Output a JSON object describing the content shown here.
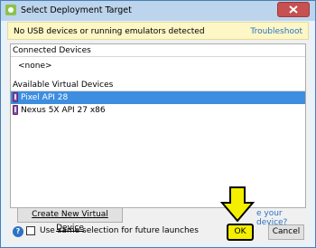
{
  "window": {
    "title": "Select Deployment Target"
  },
  "banner": {
    "message": "No USB devices or running emulators detected",
    "link": "Troubleshoot"
  },
  "connected": {
    "header": "Connected Devices",
    "empty": "<none>"
  },
  "available": {
    "header": "Available Virtual Devices",
    "devices": [
      {
        "label": "Pixel API 28",
        "selected": true
      },
      {
        "label": "Nexus 5X API 27 x86",
        "selected": false
      }
    ]
  },
  "actions": {
    "create": "Create New Virtual Device",
    "help_link": "e your device?",
    "help_icon": "?",
    "checkbox_label": "Use same selection for future launches",
    "ok": "OK",
    "cancel": "Cancel"
  },
  "colors": {
    "selection": "#3d8ee0",
    "banner": "#fdf6c5",
    "link": "#2a72c4",
    "highlight": "#f4ee00"
  }
}
